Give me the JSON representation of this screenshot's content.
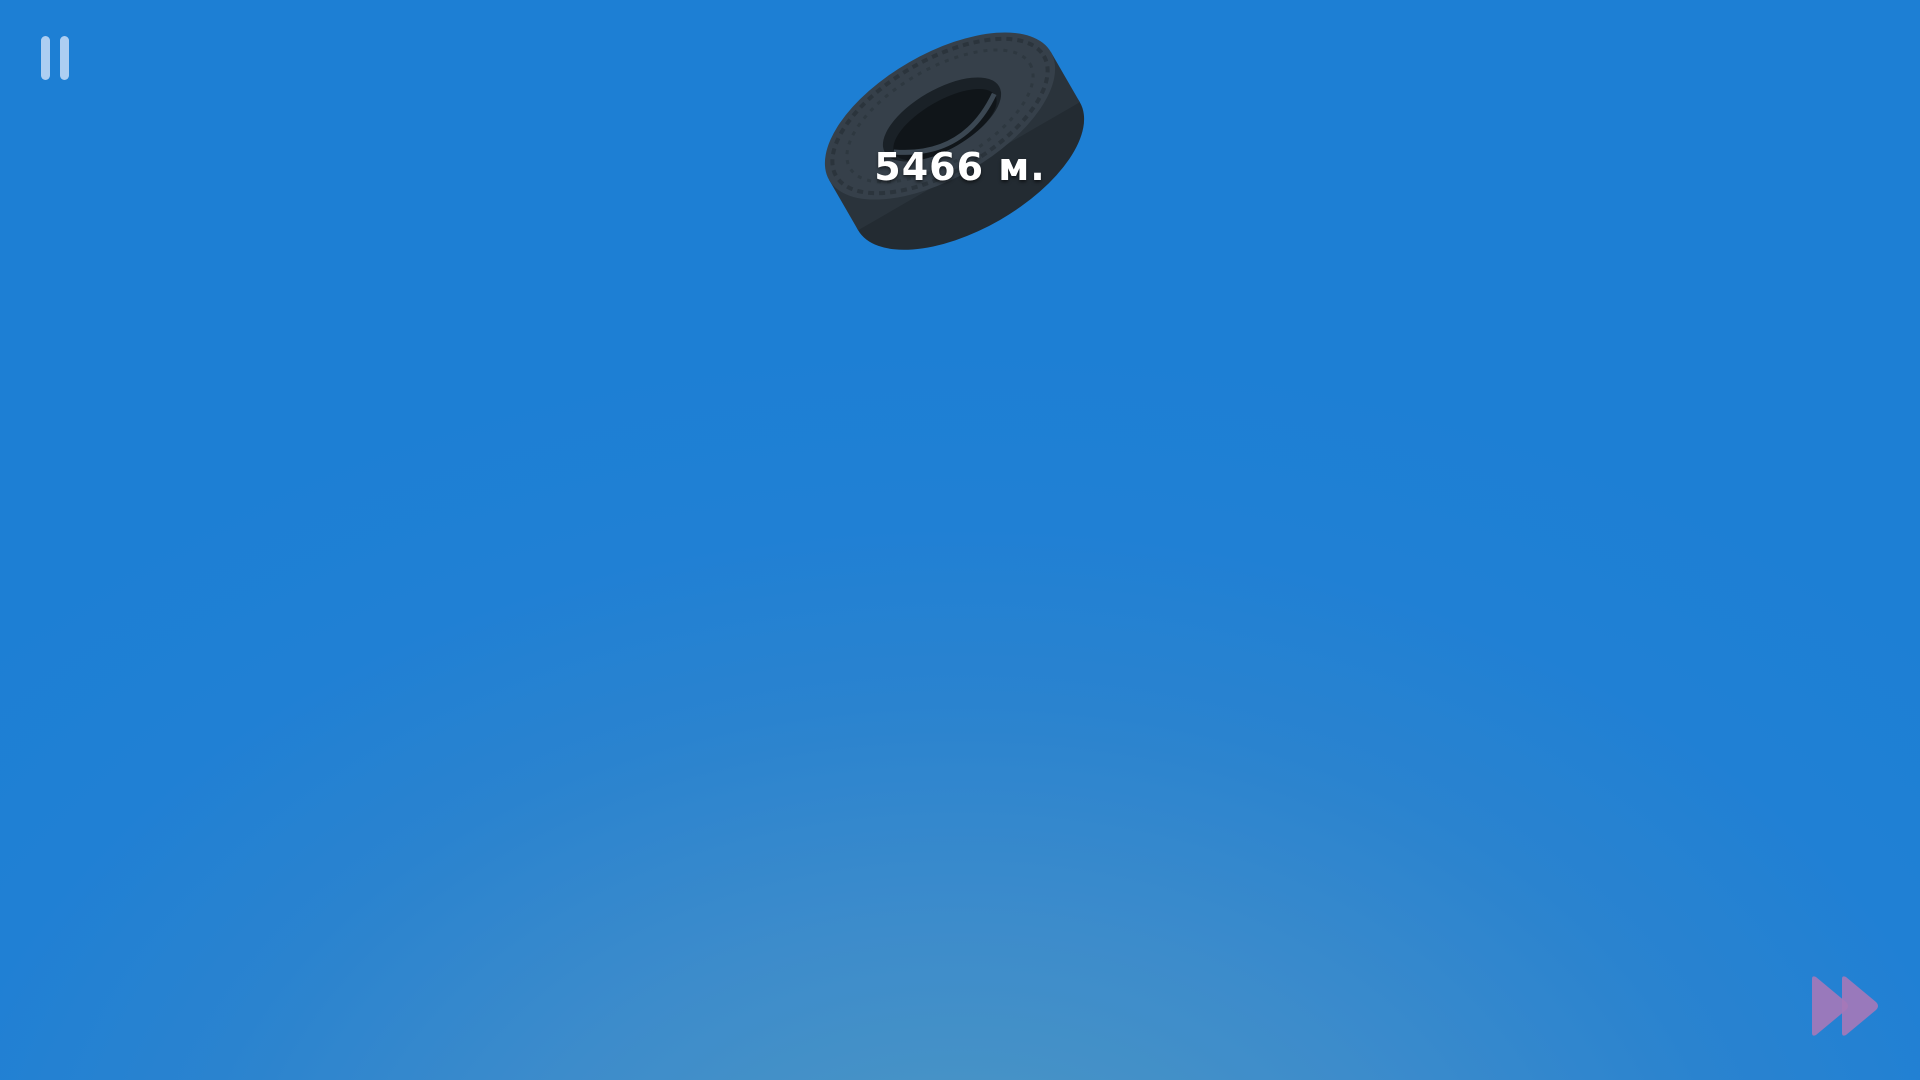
{
  "hud": {
    "distance": "5466 м.",
    "pause_icon": "pause-icon",
    "fast_forward_icon": "fast-forward-icon"
  },
  "colors": {
    "sky_top": "#1d7fd4",
    "sky_horizon": "#4f98c2",
    "tire": "#2a333b",
    "fast_forward": "#a678b8",
    "pause": "#bed7f5"
  }
}
